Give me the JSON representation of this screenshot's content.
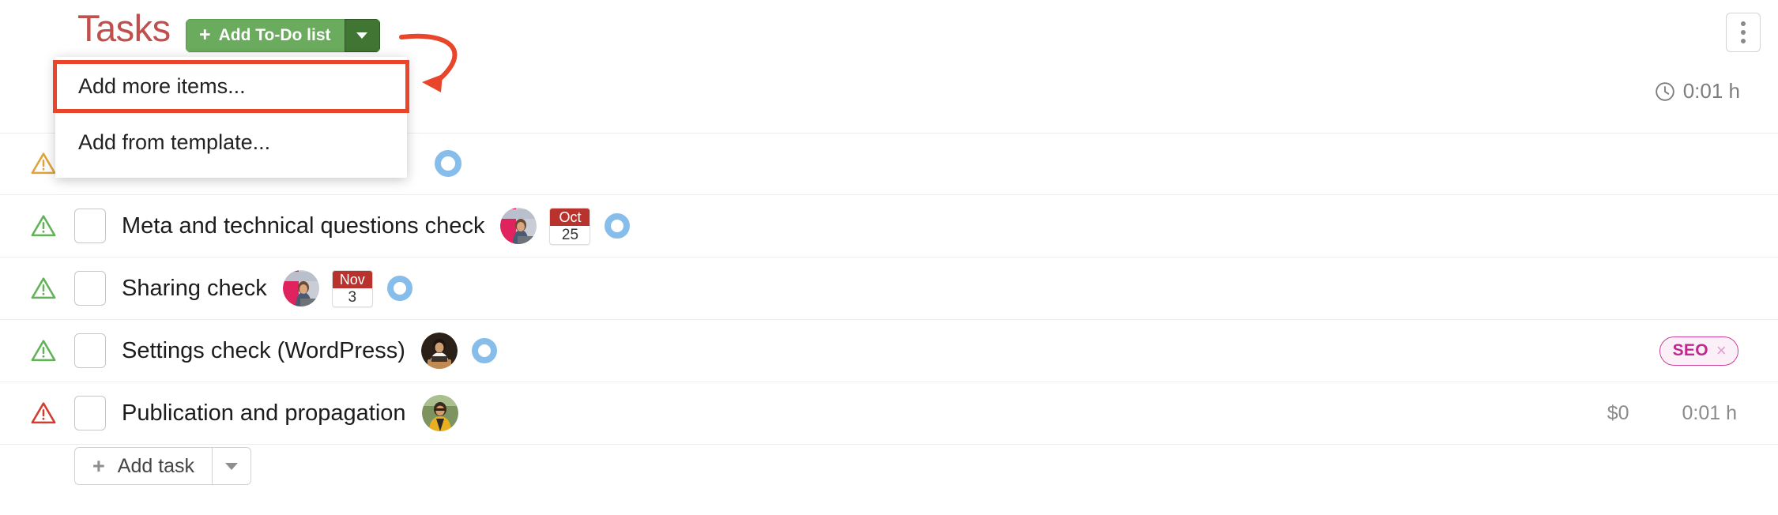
{
  "header": {
    "title": "Tasks",
    "add_todo_button": "Add To-Do list",
    "add_todo_plus": "+",
    "kebab_name": "more-options",
    "accent_red": "#c0504d",
    "button_green": "#6aab5e",
    "caret_green": "#417534"
  },
  "summary": {
    "time": "0:01 h",
    "clock_icon": "clock-icon"
  },
  "dropdown": {
    "open": true,
    "items": [
      {
        "label": "Add more items...",
        "highlighted": true
      },
      {
        "label": "Add from template...",
        "highlighted": false
      }
    ],
    "highlight_color": "#e8452a"
  },
  "annotation": {
    "arrow_color": "#e8452a",
    "arrow_name": "annotation-arrow",
    "box_name": "annotation-highlight-box"
  },
  "tasks": [
    {
      "name": "",
      "warning": "warning-triangle-icon",
      "warning_color": "#e0a33a",
      "has_checkbox": false,
      "has_avatar": false,
      "date": null,
      "progress_ring": true,
      "tag": null,
      "cost": null,
      "time": null,
      "obscured": true
    },
    {
      "name": "Meta and technical questions check",
      "warning": "warning-triangle-icon",
      "warning_color": "#62b257",
      "has_checkbox": true,
      "has_avatar": true,
      "avatar": "avatar-woman-laptop",
      "date": {
        "month": "Oct",
        "day": "25"
      },
      "progress_ring": true,
      "tag": null,
      "cost": null,
      "time": null,
      "obscured": false
    },
    {
      "name": "Sharing check",
      "warning": "warning-triangle-icon",
      "warning_color": "#62b257",
      "has_checkbox": true,
      "has_avatar": true,
      "avatar": "avatar-woman-laptop",
      "date": {
        "month": "Nov",
        "day": "3"
      },
      "progress_ring": true,
      "tag": null,
      "cost": null,
      "time": null,
      "obscured": false
    },
    {
      "name": "Settings check (WordPress)",
      "warning": "warning-triangle-icon",
      "warning_color": "#62b257",
      "has_checkbox": true,
      "has_avatar": true,
      "avatar": "avatar-person-desk",
      "date": null,
      "progress_ring": true,
      "tag": {
        "label": "SEO",
        "remove": "×",
        "color": "#c0288e"
      },
      "cost": null,
      "time": null,
      "obscured": false
    },
    {
      "name": "Publication and propagation",
      "warning": "warning-triangle-icon",
      "warning_color": "#d23b30",
      "has_checkbox": true,
      "has_avatar": true,
      "avatar": "avatar-person-outdoors",
      "date": null,
      "progress_ring": false,
      "tag": null,
      "cost": "$0",
      "time": "0:01 h",
      "obscured": false
    }
  ],
  "footer": {
    "add_task_label": "Add task",
    "add_task_plus": "+"
  }
}
